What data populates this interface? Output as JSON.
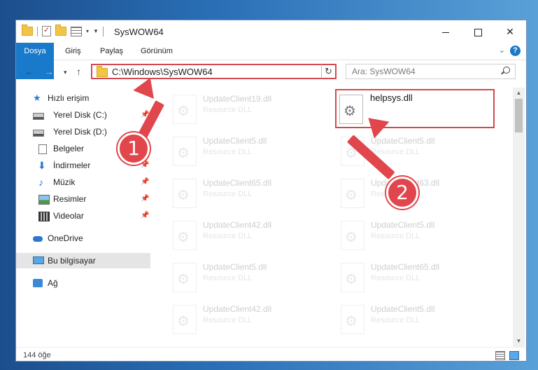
{
  "window": {
    "title": "SysWOW64",
    "controls": {
      "minimize": "—",
      "maximize": "☐",
      "close": "✕"
    }
  },
  "ribbon": {
    "tabs": [
      {
        "label": "Dosya",
        "active": true
      },
      {
        "label": "Giriş"
      },
      {
        "label": "Paylaş"
      },
      {
        "label": "Görünüm"
      }
    ],
    "help": "?"
  },
  "navigation": {
    "back": "←",
    "forward": "→",
    "up": "↑",
    "address": "C:\\Windows\\SysWOW64",
    "search_placeholder": "Ara: SysWOW64"
  },
  "sidebar": {
    "items": [
      {
        "label": "Hızlı erişim",
        "icon": "star-icon"
      },
      {
        "label": "Yerel Disk (C:)",
        "icon": "drive-icon",
        "pinned": true
      },
      {
        "label": "Yerel Disk (D:)",
        "icon": "drive-icon",
        "pinned": true
      },
      {
        "label": "Belgeler",
        "icon": "document-icon"
      },
      {
        "label": "İndirmeler",
        "icon": "download-icon",
        "pinned": true
      },
      {
        "label": "Müzik",
        "icon": "music-icon",
        "pinned": true
      },
      {
        "label": "Resimler",
        "icon": "pictures-icon",
        "pinned": true
      },
      {
        "label": "Videolar",
        "icon": "videos-icon",
        "pinned": true
      },
      {
        "label": "OneDrive",
        "icon": "cloud-icon"
      },
      {
        "label": "Bu bilgisayar",
        "icon": "computer-icon",
        "selected": true
      },
      {
        "label": "Ağ",
        "icon": "network-icon"
      }
    ]
  },
  "files": {
    "highlighted": {
      "name": "helpsys.dll"
    },
    "left_column": [
      {
        "name": "UpdateClient19.dll",
        "type": "Resource DLL"
      },
      {
        "name": "UpdateClient5.dll",
        "type": "Resource DLL"
      },
      {
        "name": "UpdateClient65.dll",
        "type": "Resource DLL"
      },
      {
        "name": "UpdateClient42.dll",
        "type": "Resource DLL"
      },
      {
        "name": "UpdateClient5.dll",
        "type": "Resource DLL"
      },
      {
        "name": "UpdateClient42.dll",
        "type": "Resource DLL"
      }
    ],
    "right_column": [
      {
        "name": "UpdateClient5.dll",
        "type": "Resource DLL"
      },
      {
        "name": "UpdateClient63.dll",
        "type": "Resource DLL"
      },
      {
        "name": "UpdateClient5.dll",
        "type": "Resource DLL"
      },
      {
        "name": "UpdateClient65.dll",
        "type": "Resource DLL"
      },
      {
        "name": "UpdateClient5.dll",
        "type": "Resource DLL"
      }
    ]
  },
  "status": {
    "item_count": "144 öğe"
  },
  "annotations": {
    "step1": "1",
    "step2": "2",
    "color": "#e0464c"
  }
}
